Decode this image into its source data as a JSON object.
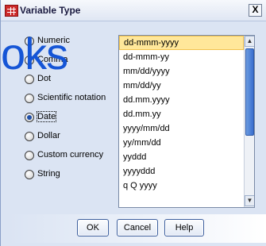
{
  "window": {
    "title": "Variable Type",
    "close_label": "X"
  },
  "watermark": "oks",
  "radio_options": [
    {
      "label": "Numeric",
      "checked": false
    },
    {
      "label": "Comma",
      "checked": false
    },
    {
      "label": "Dot",
      "checked": false
    },
    {
      "label": "Scientific notation",
      "checked": false
    },
    {
      "label": "Date",
      "checked": true
    },
    {
      "label": "Dollar",
      "checked": false
    },
    {
      "label": "Custom currency",
      "checked": false
    },
    {
      "label": "String",
      "checked": false
    }
  ],
  "date_formats": {
    "selected_index": 0,
    "items": [
      "dd-mmm-yyyy",
      "dd-mmm-yy",
      "mm/dd/yyyy",
      "mm/dd/yy",
      "dd.mm.yyyy",
      "dd.mm.yy",
      "yyyy/mm/dd",
      "yy/mm/dd",
      "yyddd",
      "yyyyddd",
      "q Q yyyy"
    ]
  },
  "buttons": {
    "ok": "OK",
    "cancel": "Cancel",
    "help": "Help"
  },
  "colors": {
    "dialog_bg": "#dbe4f3",
    "selected_item": "#ffe79a",
    "watermark": "#1555d6",
    "scroll_thumb": "#3a6fcf"
  }
}
